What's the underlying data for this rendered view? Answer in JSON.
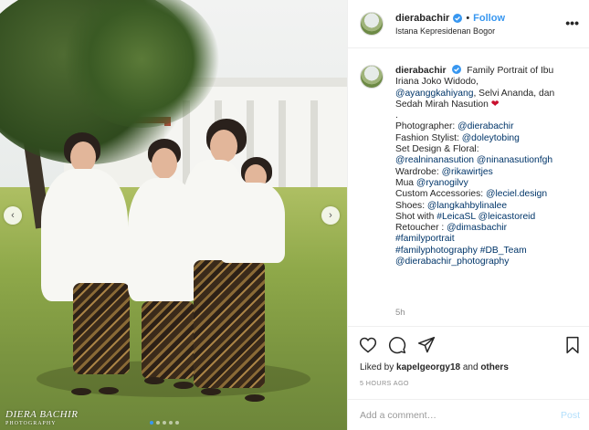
{
  "colors": {
    "accent": "#3897f0",
    "link": "#003569",
    "muted": "#8e8e8e",
    "heart": "#c8102e"
  },
  "photo": {
    "watermark_line1": "DIERA BACHIR",
    "watermark_line2": "PHOTOGRAPHY",
    "prev_icon": "chevron-left-icon",
    "next_icon": "chevron-right-icon",
    "prev_glyph": "‹",
    "next_glyph": "›",
    "carousel_dots": 5,
    "active_dot": 1
  },
  "header": {
    "username": "dierabachir",
    "separator": "•",
    "follow_label": "Follow",
    "location": "Istana Kepresidenan Bogor",
    "more_glyph": "•••"
  },
  "caption": {
    "username": "dierabachir",
    "intro": "Family Portrait of Ibu Iriana Joko Widodo, ",
    "tag1": "@ayanggkahiyang",
    "names": ", Selvi Ananda, dan Sedah Mirah Nasution ",
    "heart": "❤",
    "dot": ".",
    "photographer_label": "Photographer: ",
    "photographer": "@dierabachir",
    "stylist_label": "Fashion Stylist: ",
    "stylist": "@doleytobing",
    "floral_label": "Set Design & Floral:",
    "floral1": "@realninanasution",
    "floral2": "@ninanasutionfgh",
    "wardrobe_label": "Wardrobe: ",
    "wardrobe": "@rikawirtjes",
    "mua_label": "Mua ",
    "mua": "@ryanogilvy",
    "accessories_label": "Custom Accessories: ",
    "accessories": "@leciel.design",
    "shoes_label": "Shoes: ",
    "shoes": "@langkahbylinalee",
    "shot_label": "Shot with ",
    "shot1": "#LeicaSL",
    "shot2": "@leicastoreid",
    "retoucher_label": "Retoucher : ",
    "retoucher": "@dimasbachir",
    "hashtag1": "#familyportrait",
    "hashtag2": "#familyphotography",
    "hashtag3": "#DB_Team",
    "hashtag4": "@dierabachir_photography",
    "age": "5h"
  },
  "actions": {
    "like_icon": "heart-outline-icon",
    "comment_icon": "comment-icon",
    "share_icon": "share-icon",
    "save_icon": "bookmark-icon",
    "liked_by_prefix": "Liked by ",
    "liked_by_user": "kapelgeorgy18",
    "liked_by_suffix": " and ",
    "liked_by_others": "others",
    "timestamp": "5 HOURS AGO"
  },
  "composer": {
    "placeholder": "Add a comment…",
    "post_label": "Post"
  }
}
